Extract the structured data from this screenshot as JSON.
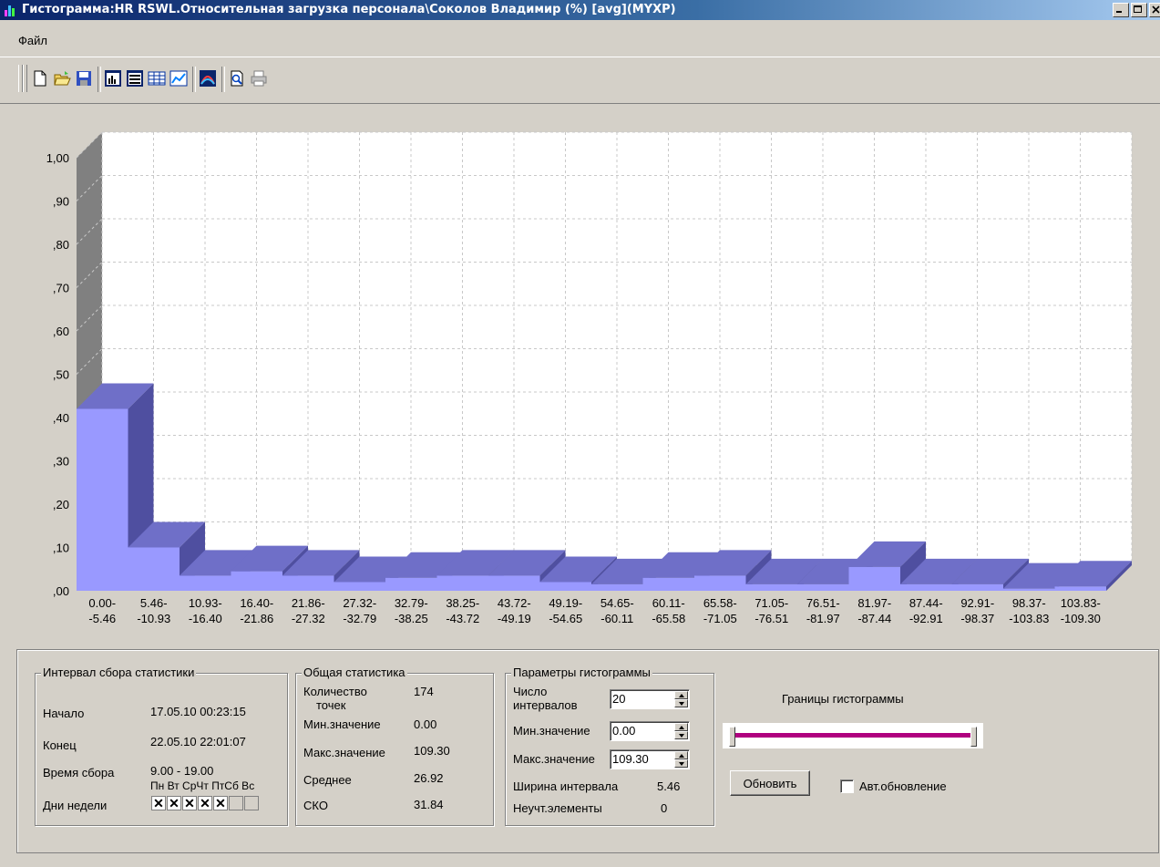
{
  "window": {
    "title": "Гистограмма:HR RSWL.Относительная загрузка персонала\\Соколов Владимир (%) [avg](MYXP)"
  },
  "menu": {
    "file": "Файл"
  },
  "toolbar": {
    "buttons": [
      "new-icon",
      "open-icon",
      "save-icon",
      "view-mode-1-icon",
      "view-mode-2-icon",
      "table-icon",
      "chart-icon",
      "3d-curve-icon",
      "print-preview-icon",
      "print-icon"
    ]
  },
  "chart_data": {
    "type": "bar",
    "categories": [
      "0.00--5.46",
      "5.46--10.93",
      "10.93--16.40",
      "16.40--21.86",
      "21.86--27.32",
      "27.32--32.79",
      "32.79--38.25",
      "38.25--43.72",
      "43.72--49.19",
      "49.19--54.65",
      "54.65--60.11",
      "60.11--65.58",
      "65.58--71.05",
      "71.05--76.51",
      "76.51--81.97",
      "81.97--87.44",
      "87.44--92.91",
      "92.91--98.37",
      "98.37--103.83",
      "103.83--109.30"
    ],
    "category_lines": [
      [
        "0.00-",
        "-5.46"
      ],
      [
        "5.46-",
        "-10.93"
      ],
      [
        "10.93-",
        "-16.40"
      ],
      [
        "16.40-",
        "-21.86"
      ],
      [
        "21.86-",
        "-27.32"
      ],
      [
        "27.32-",
        "-32.79"
      ],
      [
        "32.79-",
        "-38.25"
      ],
      [
        "38.25-",
        "-43.72"
      ],
      [
        "43.72-",
        "-49.19"
      ],
      [
        "49.19-",
        "-54.65"
      ],
      [
        "54.65-",
        "-60.11"
      ],
      [
        "60.11-",
        "-65.58"
      ],
      [
        "65.58-",
        "-71.05"
      ],
      [
        "71.05-",
        "-76.51"
      ],
      [
        "76.51-",
        "-81.97"
      ],
      [
        "81.97-",
        "-87.44"
      ],
      [
        "87.44-",
        "-92.91"
      ],
      [
        "92.91-",
        "-98.37"
      ],
      [
        "98.37-",
        "-103.83"
      ],
      [
        "103.83-",
        "-109.30"
      ]
    ],
    "values": [
      0.42,
      0.1,
      0.035,
      0.045,
      0.035,
      0.02,
      0.03,
      0.035,
      0.035,
      0.02,
      0.015,
      0.03,
      0.035,
      0.015,
      0.015,
      0.055,
      0.015,
      0.015,
      0.005,
      0.01
    ],
    "ylim": [
      0,
      1.0
    ],
    "yticks": [
      ",00",
      ",10",
      ",20",
      ",30",
      ",40",
      ",50",
      ",60",
      ",70",
      ",80",
      ",90",
      "1,00"
    ],
    "grid": true,
    "colors": {
      "bar_front": "#9999ff",
      "bar_top": "#6f6fc8",
      "bar_side": "#4f4fa0",
      "wall": "#808080",
      "plot_bg": "#ffffff"
    }
  },
  "stats_interval": {
    "legend": "Интервал сбора статистики",
    "start_label": "Начало",
    "start_value": "17.05.10 00:23:15",
    "end_label": "Конец",
    "end_value": "22.05.10 22:01:07",
    "time_label": "Время сбора",
    "time_value": "9.00 - 19.00",
    "days_header": "Пн Вт СрЧт ПтСб Вс",
    "days_label": "Дни недели",
    "days": [
      true,
      true,
      true,
      true,
      true,
      false,
      false
    ],
    "check_mark": "✕"
  },
  "general_stats": {
    "legend": "Общая статистика",
    "count_label_1": "Количество",
    "count_label_2": "точек",
    "count_value": "174",
    "min_label": "Мин.значение",
    "min_value": "0.00",
    "max_label": "Макс.значение",
    "max_value": "109.30",
    "mean_label": "Среднее",
    "mean_value": "26.92",
    "sko_label": "СКО",
    "sko_value": "31.84"
  },
  "hist_params": {
    "legend": "Параметры гистограммы",
    "num_label_1": "Число",
    "num_label_2": "интервалов",
    "num_value": "20",
    "min_label": "Мин.значение",
    "min_value": "0.00",
    "max_label": "Макс.значение",
    "max_value": "109.30",
    "width_label": "Ширина интервала",
    "width_value": "5.46",
    "ignored_label": "Неучт.элементы",
    "ignored_value": "0"
  },
  "bounds": {
    "title": "Границы гистограммы",
    "range_lower": 0.0,
    "range_upper": 1.0
  },
  "actions": {
    "refresh_label": "Обновить",
    "auto_update_label": "Авт.обновление",
    "auto_update_checked": false
  }
}
